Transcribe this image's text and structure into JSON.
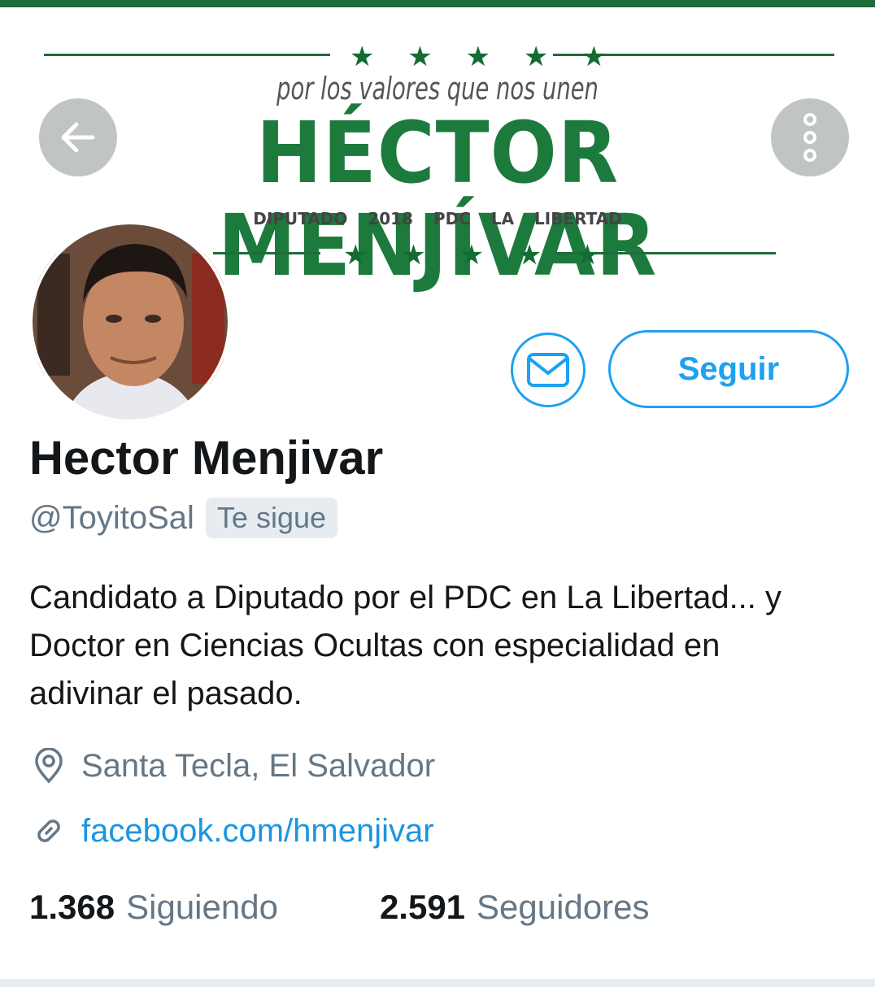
{
  "banner": {
    "stars_top": "★ ★ ★ ★ ★",
    "slogan": "por los valores que nos unen",
    "big_name": "HÉCTOR MENJÍVAR",
    "subline": "DIPUTADO 2018   PDC LA LIBERTAD",
    "stars_bottom": "★ ★ ★ ★ ★",
    "brand_color": "#1c7a3c"
  },
  "nav": {
    "back_icon": "arrow-left-icon",
    "more_icon": "more-vertical-icon"
  },
  "actions": {
    "message_icon": "envelope-icon",
    "follow_label": "Seguir",
    "accent_color": "#1da1f2"
  },
  "profile": {
    "name": "Hector Menjivar",
    "handle": "@ToyitoSal",
    "follows_you": "Te sigue",
    "bio": "Candidato a Diputado por el PDC en La Libertad... y Doctor en Ciencias Ocultas con especialidad en adivinar el pasado.",
    "location": "Santa Tecla, El Salvador",
    "location_icon": "map-pin-icon",
    "website": "facebook.com/hmenjivar",
    "website_icon": "link-icon"
  },
  "stats": {
    "following_count": "1.368",
    "following_label": "Siguiendo",
    "followers_count": "2.591",
    "followers_label": "Seguidores"
  }
}
